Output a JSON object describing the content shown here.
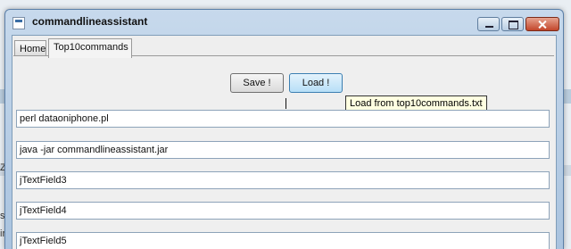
{
  "window": {
    "title": "commandlineassistant"
  },
  "tabs": [
    {
      "label": "Home",
      "active": false
    },
    {
      "label": "Top10commands",
      "active": true
    }
  ],
  "toolbar": {
    "save_label": "Save !",
    "load_label": "Load !"
  },
  "tooltip": {
    "text": "Load from top10commands.txt"
  },
  "fields": [
    {
      "value": "perl dataoniphone.pl"
    },
    {
      "value": "java -jar commandlineassistant.jar"
    },
    {
      "value": "jTextField3"
    },
    {
      "value": "jTextField4"
    },
    {
      "value": "jTextField5"
    }
  ],
  "background": {
    "edge_letters": [
      "ZZ",
      "s",
      "ir"
    ]
  }
}
